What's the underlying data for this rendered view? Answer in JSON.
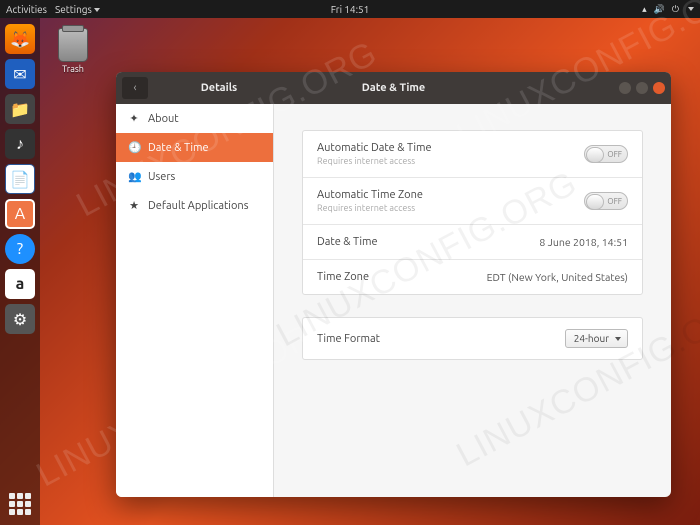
{
  "topbar": {
    "activities": "Activities",
    "app_menu": "Settings",
    "clock": "Fri 14:51"
  },
  "desktop": {
    "trash_label": "Trash"
  },
  "window": {
    "section_title": "Details",
    "title": "Date & Time"
  },
  "sidebar": {
    "items": [
      {
        "icon": "✦",
        "label": "About"
      },
      {
        "icon": "🕘",
        "label": "Date & Time"
      },
      {
        "icon": "👥",
        "label": "Users"
      },
      {
        "icon": "★",
        "label": "Default Applications"
      }
    ],
    "active_index": 1
  },
  "settings": {
    "auto_dt_label": "Automatic Date & Time",
    "auto_dt_sub": "Requires internet access",
    "auto_dt_state": "OFF",
    "auto_tz_label": "Automatic Time Zone",
    "auto_tz_sub": "Requires internet access",
    "auto_tz_state": "OFF",
    "dt_label": "Date & Time",
    "dt_value": "8 June 2018, 14:51",
    "tz_label": "Time Zone",
    "tz_value": "EDT (New York, United States)",
    "fmt_label": "Time Format",
    "fmt_value": "24-hour"
  },
  "watermark": "LINUXCONFIG.ORG"
}
